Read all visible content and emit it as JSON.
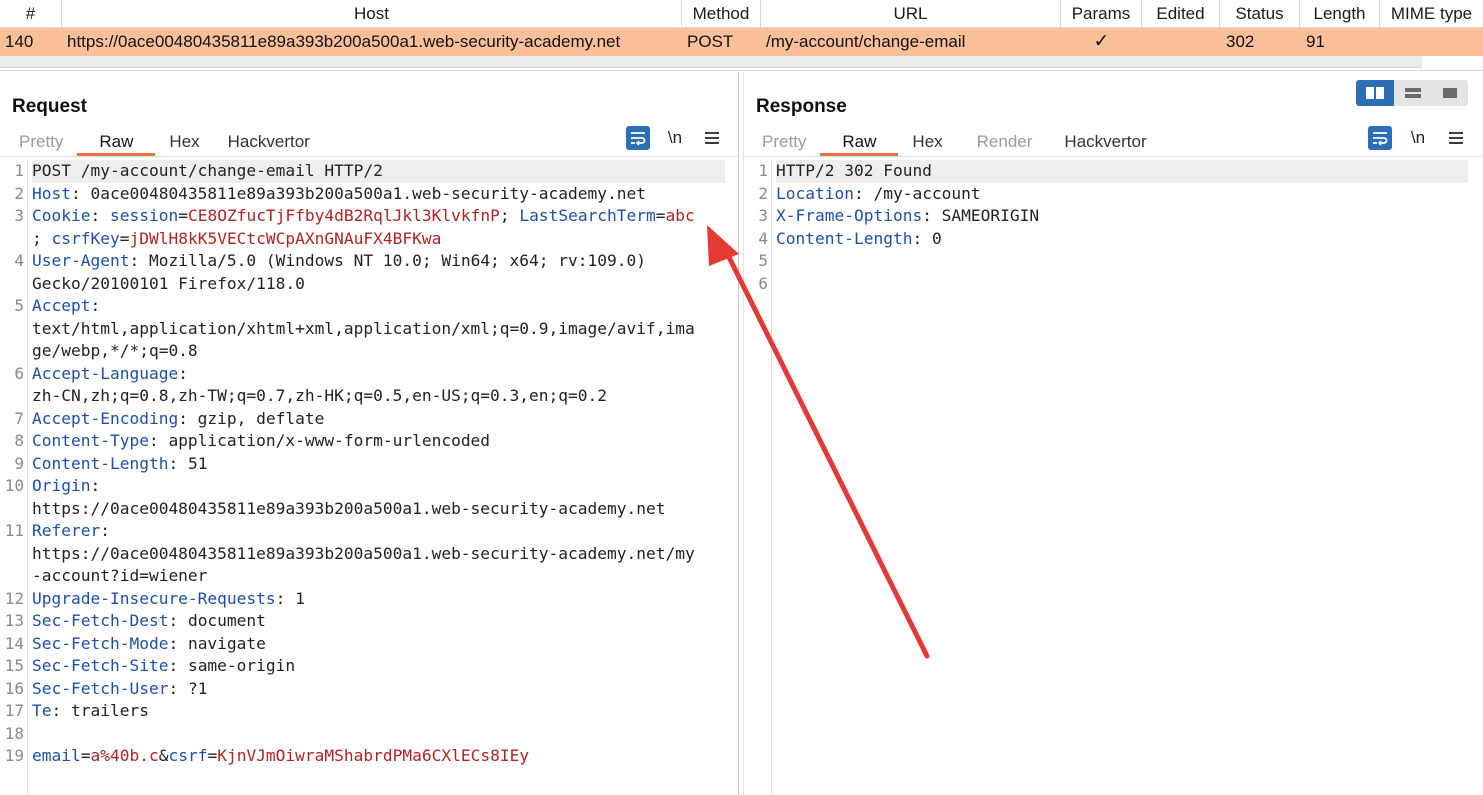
{
  "table": {
    "columns": [
      "#",
      "Host",
      "Method",
      "URL",
      "Params",
      "Edited",
      "Status",
      "Length",
      "MIME type"
    ],
    "row": {
      "num": "140",
      "host": "https://0ace00480435811e89a393b200a500a1.web-security-academy.net",
      "method": "POST",
      "url": "/my-account/change-email",
      "params": "✓",
      "edited": "",
      "status": "302",
      "length": "91",
      "mime": ""
    },
    "highlight_color": "#fbc09a"
  },
  "request": {
    "title": "Request",
    "tabs": [
      "Pretty",
      "Raw",
      "Hex",
      "Hackvertor"
    ],
    "active_tab": "Raw",
    "newline_label": "\\n",
    "line_numbers": [
      "1",
      "2",
      "3",
      "4",
      "5",
      "6",
      "7",
      "8",
      "9",
      "10",
      "11",
      "12",
      "13",
      "14",
      "15",
      "16",
      "17",
      "18",
      "19"
    ],
    "lines": {
      "l1": "POST /my-account/change-email HTTP/2",
      "l2k": "Host",
      "l2v": ": 0ace00480435811e89a393b200a500a1.web-security-academy.net",
      "l3k": "Cookie",
      "l3s": ": ",
      "l3a": "session",
      "l3b": "=",
      "l3c": "CE8OZfucTjFfby4dB2RqlJkl3KlvkfnP",
      "l3d": "; ",
      "l3e": "LastSearchTerm",
      "l3f": "=",
      "l3g": "abc",
      "l3h": "; ",
      "l3i": "csrfKey",
      "l3j": "=",
      "l3l": "jDWlH8kK5VECtcWCpAXnGNAuFX4BFKwa",
      "l4k": "User-Agent",
      "l4v": ": Mozilla/5.0 (Windows NT 10.0; Win64; x64; rv:109.0)",
      "l4w": "Gecko/20100101 Firefox/118.0",
      "l5k": "Accept",
      "l5s": ":",
      "l5v": "text/html,application/xhtml+xml,application/xml;q=0.9,image/avif,ima",
      "l5w": "ge/webp,*/*;q=0.8",
      "l6k": "Accept-Language",
      "l6s": ":",
      "l6v": "zh-CN,zh;q=0.8,zh-TW;q=0.7,zh-HK;q=0.5,en-US;q=0.3,en;q=0.2",
      "l7k": "Accept-Encoding",
      "l7v": ": gzip, deflate",
      "l8k": "Content-Type",
      "l8v": ": application/x-www-form-urlencoded",
      "l9k": "Content-Length",
      "l9v": ": 51",
      "l10k": "Origin",
      "l10s": ":",
      "l10v": "https://0ace00480435811e89a393b200a500a1.web-security-academy.net",
      "l11k": "Referer",
      "l11s": ":",
      "l11v": "https://0ace00480435811e89a393b200a500a1.web-security-academy.net/my",
      "l11w": "-account?id=wiener",
      "l12k": "Upgrade-Insecure-Requests",
      "l12v": ": 1",
      "l13k": "Sec-Fetch-Dest",
      "l13v": ": document",
      "l14k": "Sec-Fetch-Mode",
      "l14v": ": navigate",
      "l15k": "Sec-Fetch-Site",
      "l15v": ": same-origin",
      "l16k": "Sec-Fetch-User",
      "l16v": ": ?1",
      "l17k": "Te",
      "l17v": ": trailers",
      "l19a": "email",
      "l19b": "=",
      "l19c": "a%40b.c",
      "l19d": "&",
      "l19e": "csrf",
      "l19f": "=",
      "l19g": "KjnVJmOiwraMShabrdPMa6CXlECs8IEy"
    }
  },
  "response": {
    "title": "Response",
    "tabs": [
      "Pretty",
      "Raw",
      "Hex",
      "Render",
      "Hackvertor"
    ],
    "active_tab": "Raw",
    "newline_label": "\\n",
    "line_numbers": [
      "1",
      "2",
      "3",
      "4",
      "5",
      "6"
    ],
    "lines": {
      "l1": "HTTP/2 302 Found",
      "l2k": "Location",
      "l2v": ": /my-account",
      "l3k": "X-Frame-Options",
      "l3v": ": SAMEORIGIN",
      "l4k": "Content-Length",
      "l4v": ": 0"
    }
  },
  "colors": {
    "accent": "#2c6fb7",
    "active_tab_underline": "#e7733a",
    "header_name": "#1d4fa8",
    "param_value": "#b02323",
    "annotation_arrow": "#e53935"
  },
  "icons": {
    "wrap": "word-wrap-icon",
    "newline": "newline-icon",
    "menu": "hamburger-menu-icon",
    "arrow": "red-arrow-annotation"
  }
}
